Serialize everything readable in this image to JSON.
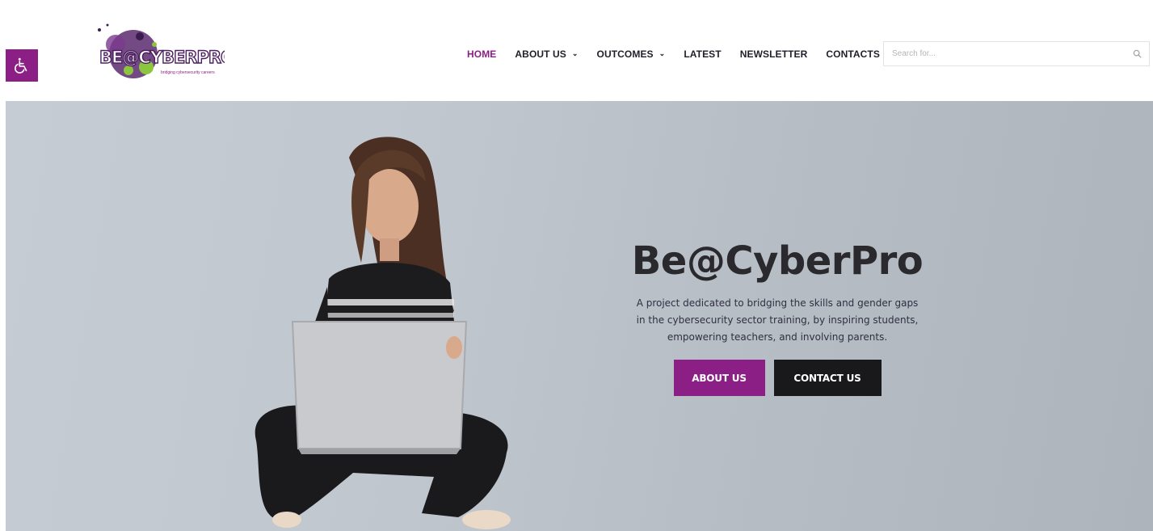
{
  "accessibility": {
    "icon": "wheelchair-icon"
  },
  "logo": {
    "text": "BE@CYBERPRO",
    "tagline": "bridging cybersecurity careers"
  },
  "nav": {
    "items": [
      {
        "label": "HOME",
        "active": true,
        "dropdown": false
      },
      {
        "label": "ABOUT US",
        "active": false,
        "dropdown": true
      },
      {
        "label": "OUTCOMES",
        "active": false,
        "dropdown": true
      },
      {
        "label": "LATEST",
        "active": false,
        "dropdown": false
      },
      {
        "label": "NEWSLETTER",
        "active": false,
        "dropdown": false
      },
      {
        "label": "CONTACTS",
        "active": false,
        "dropdown": false
      }
    ],
    "dropdown_icon": "chevron-down-icon"
  },
  "search": {
    "placeholder": "Search for...",
    "value": "",
    "icon": "search-icon"
  },
  "hero": {
    "title": "Be@CyberPro",
    "description": "A project dedicated to bridging the skills and gender gaps in the cybersecurity sector training, by inspiring students, empowering teachers, and involving parents.",
    "buttons": {
      "about_label": "ABOUT US",
      "contact_label": "CONTACT US"
    }
  },
  "colors": {
    "accent": "#8b1f85",
    "dark": "#19191b",
    "nav_text": "#1f1f2a",
    "hero_background": "#c1c7cf"
  }
}
